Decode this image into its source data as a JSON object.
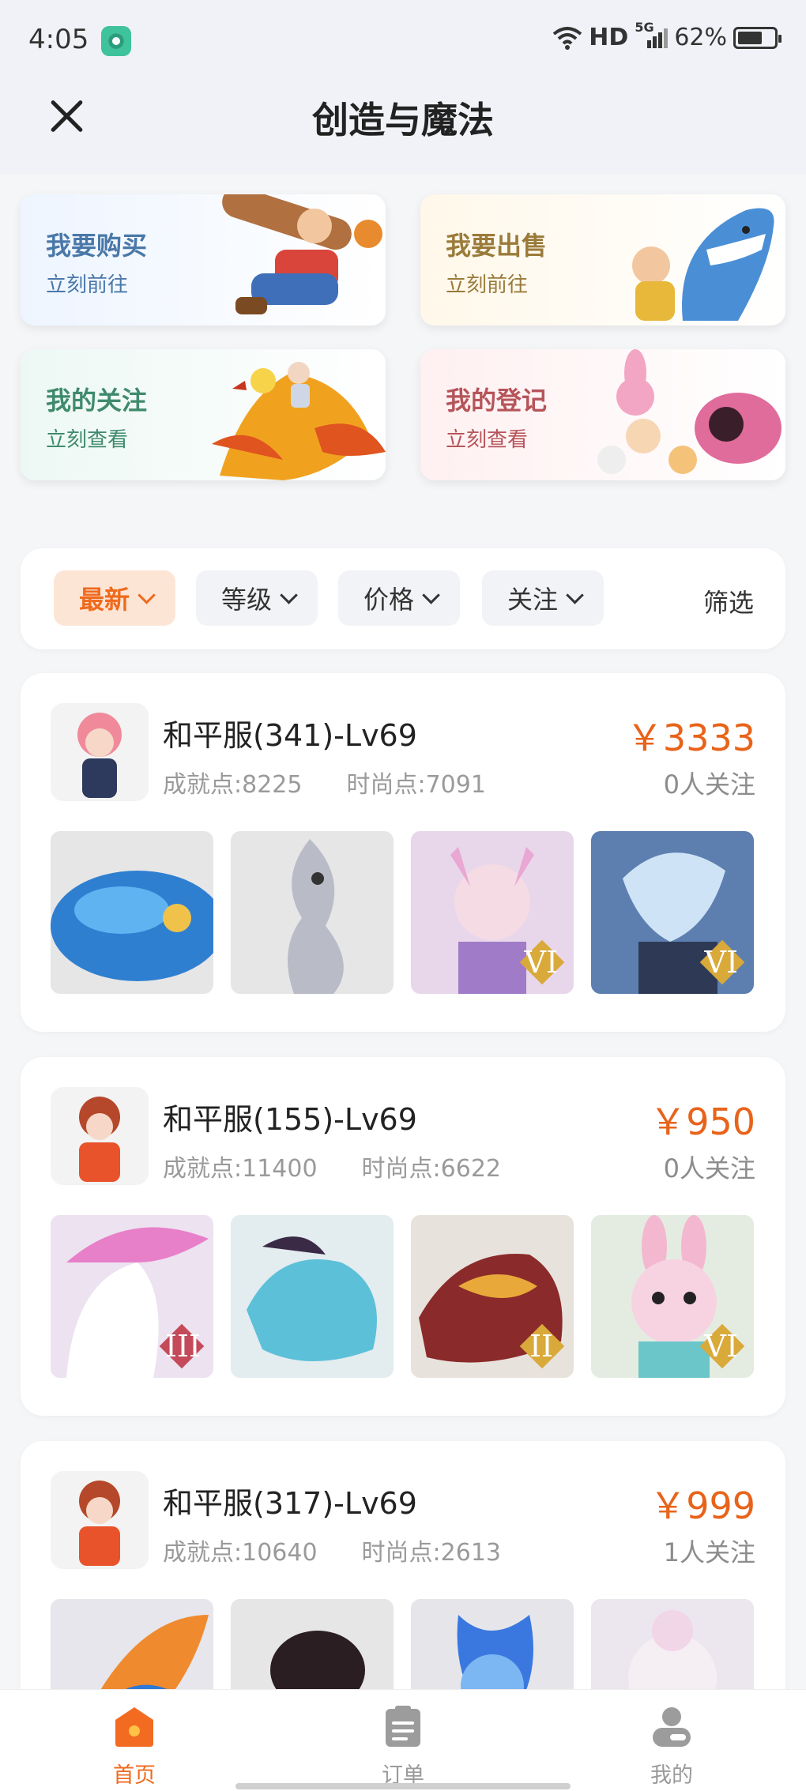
{
  "status_bar": {
    "time": "4:05",
    "network": "HD",
    "signal_label": "5G",
    "battery": "62%"
  },
  "header": {
    "title": "创造与魔法"
  },
  "entries": [
    {
      "title": "我要购买",
      "subtitle": "立刻前往"
    },
    {
      "title": "我要出售",
      "subtitle": "立刻前往"
    },
    {
      "title": "我的关注",
      "subtitle": "立刻查看"
    },
    {
      "title": "我的登记",
      "subtitle": "立刻查看"
    }
  ],
  "filters": {
    "newest": "最新",
    "level": "等级",
    "price": "价格",
    "follow": "关注",
    "screen": "筛选"
  },
  "listings": [
    {
      "server": "和平服(341)-Lv69",
      "achievement": "成就点:8225",
      "fashion": "时尚点:7091",
      "price": "￥3333",
      "followers": "0人关注",
      "badges": [
        "",
        "",
        "VI",
        "VI"
      ]
    },
    {
      "server": "和平服(155)-Lv69",
      "achievement": "成就点:11400",
      "fashion": "时尚点:6622",
      "price": "￥950",
      "followers": "0人关注",
      "badges": [
        "III",
        "",
        "II",
        "VI"
      ]
    },
    {
      "server": "和平服(317)-Lv69",
      "achievement": "成就点:10640",
      "fashion": "时尚点:2613",
      "price": "￥999",
      "followers": "1人关注",
      "badges": [
        "",
        "",
        "",
        ""
      ]
    }
  ],
  "bottom_nav": {
    "home": "首页",
    "orders": "订单",
    "mine": "我的"
  },
  "colors": {
    "accent": "#ef6a1e",
    "price": "#e8631a"
  }
}
